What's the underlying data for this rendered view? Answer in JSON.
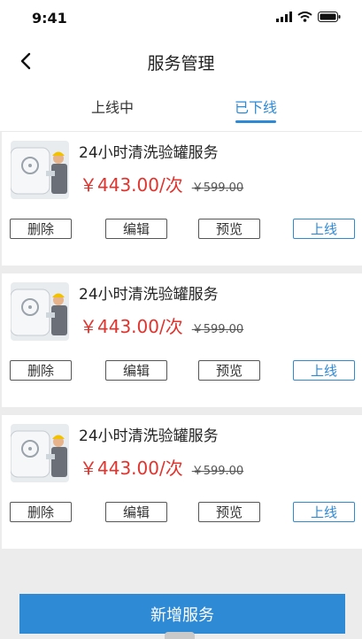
{
  "status_bar": {
    "time": "9:41"
  },
  "header": {
    "title": "服务管理"
  },
  "tabs": [
    {
      "label": "上线中",
      "active": false
    },
    {
      "label": "已下线",
      "active": true
    }
  ],
  "services": [
    {
      "name": "24小时清洗验罐服务",
      "price": "￥443.00/次",
      "original_price": "￥599.00",
      "actions": {
        "delete": "删除",
        "edit": "编辑",
        "preview": "预览",
        "online": "上线"
      }
    },
    {
      "name": "24小时清洗验罐服务",
      "price": "￥443.00/次",
      "original_price": "￥599.00",
      "actions": {
        "delete": "删除",
        "edit": "编辑",
        "preview": "预览",
        "online": "上线"
      }
    },
    {
      "name": "24小时清洗验罐服务",
      "price": "￥443.00/次",
      "original_price": "￥599.00",
      "actions": {
        "delete": "删除",
        "edit": "编辑",
        "preview": "预览",
        "online": "上线"
      }
    }
  ],
  "footer": {
    "add_label": "新增服务"
  },
  "colors": {
    "accent": "#2f8ad6",
    "price": "#e0342f",
    "background": "#ececec"
  }
}
